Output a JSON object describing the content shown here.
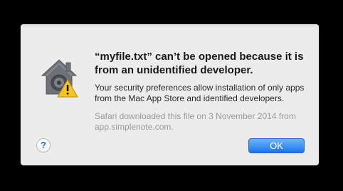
{
  "dialog": {
    "title": "“myfile.txt” can’t be opened because it is from an unidentified developer.",
    "body": "Your security preferences allow installation of only apps from the Mac App Store and identified developers.",
    "note": "Safari downloaded this file on 3 November 2014 from app.simplenote.com.",
    "icon": "gatekeeper-warning-icon",
    "help_label": "?",
    "ok_label": "OK"
  },
  "colors": {
    "accent": "#1b76f0",
    "warning": "#f6c321",
    "background": "#ececec"
  }
}
